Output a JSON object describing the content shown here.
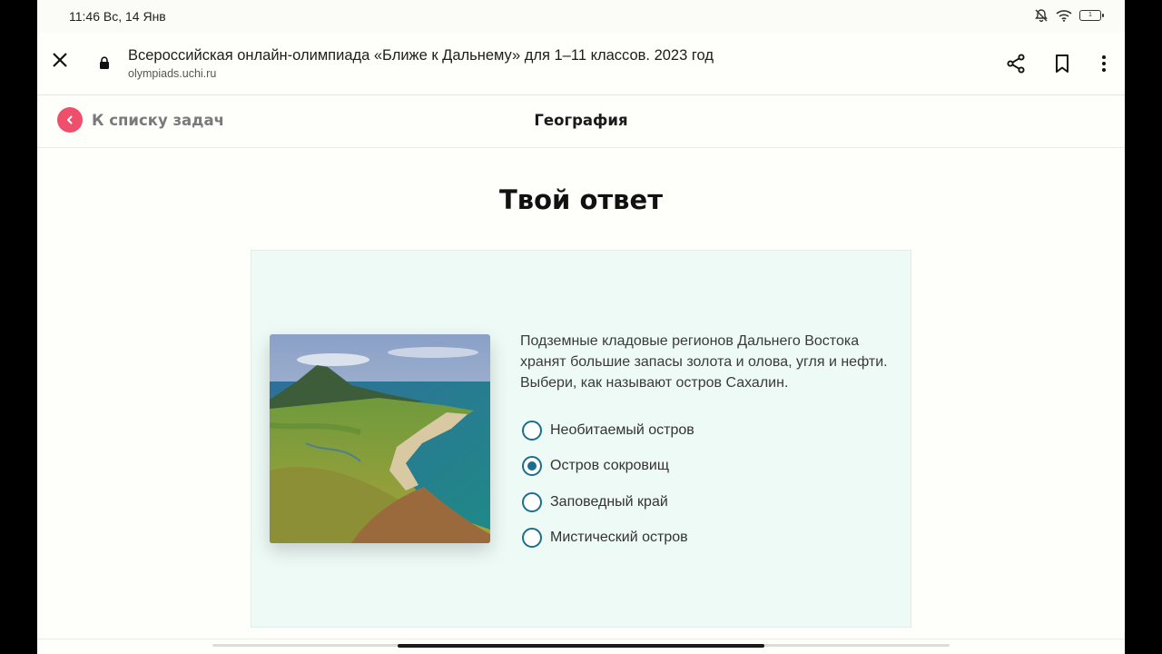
{
  "status_bar": {
    "time": "11:46 Вс, 14 Янв",
    "battery": "1",
    "icons": [
      "bell-off-icon",
      "wifi-icon",
      "battery-icon"
    ]
  },
  "browser": {
    "page_title": "Всероссийская онлайн-олимпиада «Ближе к Дальнему» для 1–11 классов. 2023 год",
    "url": "olympiads.uchi.ru",
    "icons": [
      "close-icon",
      "lock-icon",
      "share-icon",
      "bookmark-icon",
      "more-vert-icon"
    ]
  },
  "header": {
    "back_label": "К списку задач",
    "subject": "География"
  },
  "main": {
    "heading": "Твой ответ",
    "question": "Подземные кладовые регионов Дальнего Востока хранят большие запасы золота и олова, угля и нефти. Выбери, как называют остров Сахалин.",
    "options": [
      {
        "label": "Необитаемый остров",
        "selected": false
      },
      {
        "label": "Остров сокровищ",
        "selected": true
      },
      {
        "label": "Заповедный край",
        "selected": false
      },
      {
        "label": "Мистический остров",
        "selected": false
      }
    ]
  },
  "colors": {
    "accent": "#ef4f6b",
    "radio": "#1b6e8e",
    "card_bg": "#eefaf6"
  }
}
